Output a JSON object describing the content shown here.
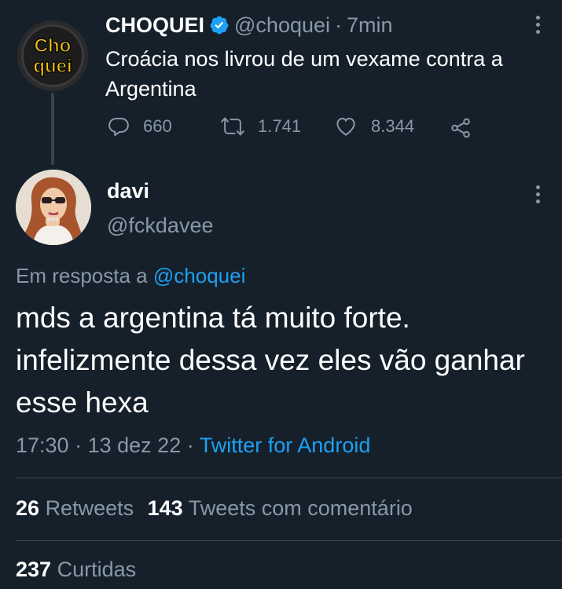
{
  "parent": {
    "avatar_text_top": "Cho",
    "avatar_text_bottom": "quei",
    "name": "CHOQUEI",
    "handle": "@choquei",
    "separator": "·",
    "time": "7min",
    "text": "Croácia nos livrou de um vexame contra a Argentina",
    "actions": {
      "replies": "660",
      "retweets": "1.741",
      "likes": "8.344"
    }
  },
  "reply": {
    "name": "davi",
    "handle": "@fckdavee",
    "in_reply_prefix": "Em resposta a",
    "in_reply_handle": "@choquei",
    "text": "mds a argentina tá muito forte. infelizmente dessa vez eles vão ganhar esse hexa",
    "time": "17:30",
    "date": "13 dez 22",
    "separator": "·",
    "source": "Twitter for Android",
    "retweets_count": "26",
    "retweets_label": "Retweets",
    "quotes_count": "143",
    "quotes_label": "Tweets com comentário",
    "likes_count": "237",
    "likes_label": "Curtidas"
  },
  "colors": {
    "background": "#15202b",
    "muted": "#8899a6",
    "link": "#1da1f2",
    "verified": "#1da1f2",
    "logo_yellow": "#f5c518"
  }
}
